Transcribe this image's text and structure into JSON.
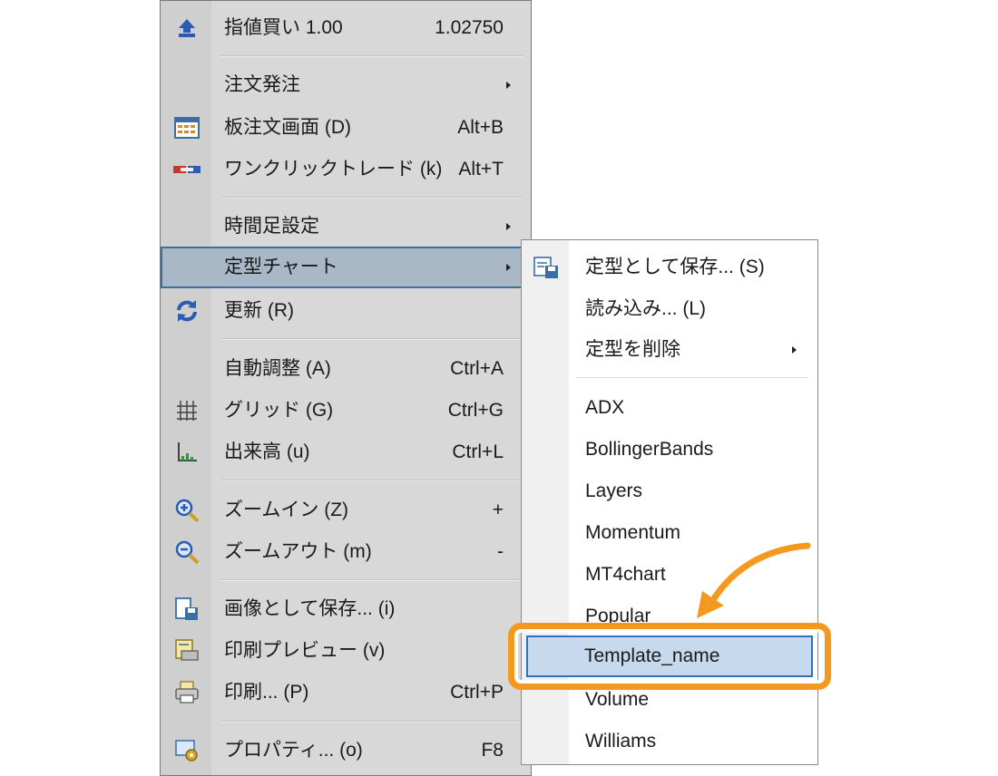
{
  "main_menu": {
    "items": [
      {
        "label": "指値買い 1.00",
        "accel": "1.02750",
        "icon": "buy-arrow-icon"
      },
      {
        "label": "注文発注",
        "submenu": true
      },
      {
        "label": "板注文画面 (D)",
        "accel": "Alt+B",
        "icon": "order-board-icon"
      },
      {
        "label": "ワンクリックトレード (k)",
        "accel": "Alt+T",
        "icon": "one-click-trade-icon"
      },
      {
        "label": "時間足設定",
        "submenu": true
      },
      {
        "label": "定型チャート",
        "submenu": true,
        "selected": true
      },
      {
        "label": "更新 (R)",
        "icon": "refresh-icon"
      },
      {
        "label": "自動調整 (A)",
        "accel": "Ctrl+A"
      },
      {
        "label": "グリッド (G)",
        "accel": "Ctrl+G",
        "icon": "grid-icon"
      },
      {
        "label": "出来高 (u)",
        "accel": "Ctrl+L",
        "icon": "volume-icon"
      },
      {
        "label": "ズームイン (Z)",
        "accel": "+",
        "icon": "zoom-in-icon"
      },
      {
        "label": "ズームアウト (m)",
        "accel": "-",
        "icon": "zoom-out-icon"
      },
      {
        "label": "画像として保存... (i)",
        "icon": "save-image-icon"
      },
      {
        "label": "印刷プレビュー (v)",
        "icon": "print-preview-icon"
      },
      {
        "label": "印刷... (P)",
        "accel": "Ctrl+P",
        "icon": "printer-icon"
      },
      {
        "label": "プロパティ... (o)",
        "accel": "F8",
        "icon": "properties-icon"
      }
    ]
  },
  "sub_menu": {
    "items": [
      {
        "label": "定型として保存... (S)",
        "icon": "save-template-icon"
      },
      {
        "label": "読み込み... (L)"
      },
      {
        "label": "定型を削除",
        "submenu": true
      },
      {
        "label": "ADX"
      },
      {
        "label": "BollingerBands"
      },
      {
        "label": "Layers"
      },
      {
        "label": "Momentum"
      },
      {
        "label": "MT4chart"
      },
      {
        "label": "Popular"
      },
      {
        "label": "Template_name",
        "selected": true
      },
      {
        "label": "Volume"
      },
      {
        "label": "Williams"
      }
    ]
  },
  "colors": {
    "highlight_frame": "#f39a1e",
    "selection": "#c7d9ec",
    "selection_border": "#2f72b8",
    "menu_bg": "#d8d8d8"
  }
}
